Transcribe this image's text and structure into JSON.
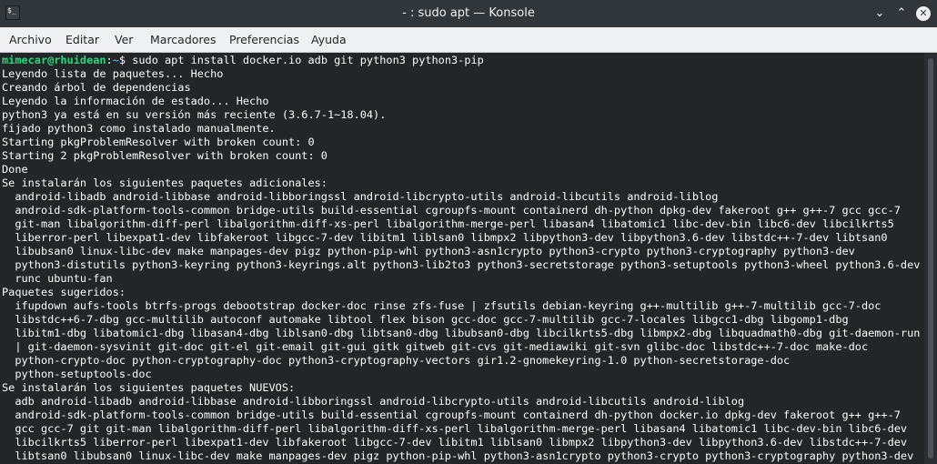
{
  "window": {
    "app_icon_text": "$_",
    "title": "- : sudo apt — Konsole",
    "minimize_glyph": "⌄",
    "maximize_glyph": "⌃",
    "close_glyph": "✕"
  },
  "menu": [
    "Archivo",
    "Editar",
    "Ver",
    "Marcadores",
    "Preferencias",
    "Ayuda"
  ],
  "terminal": {
    "prompt_user": "mimecar@rhuidean",
    "prompt_sep": ":",
    "prompt_path": "~",
    "prompt_symbol": "$ ",
    "command": "sudo apt install docker.io adb git python3 python3-pip",
    "lines": [
      "Leyendo lista de paquetes... Hecho",
      "Creando árbol de dependencias",
      "Leyendo la información de estado... Hecho",
      "python3 ya está en su versión más reciente (3.6.7-1~18.04).",
      "fijado python3 como instalado manualmente.",
      "Starting pkgProblemResolver with broken count: 0",
      "Starting 2 pkgProblemResolver with broken count: 0",
      "Done",
      "Se instalarán los siguientes paquetes adicionales:",
      "  android-libadb android-libbase android-libboringssl android-libcrypto-utils android-libcutils android-liblog",
      "  android-sdk-platform-tools-common bridge-utils build-essential cgroupfs-mount containerd dh-python dpkg-dev fakeroot g++ g++-7 gcc gcc-7",
      "  git-man libalgorithm-diff-perl libalgorithm-diff-xs-perl libalgorithm-merge-perl libasan4 libatomic1 libc-dev-bin libc6-dev libcilkrts5",
      "  liberror-perl libexpat1-dev libfakeroot libgcc-7-dev libitm1 liblsan0 libmpx2 libpython3-dev libpython3.6-dev libstdc++-7-dev libtsan0",
      "  libubsan0 linux-libc-dev make manpages-dev pigz python-pip-whl python3-asn1crypto python3-crypto python3-cryptography python3-dev",
      "  python3-distutils python3-keyring python3-keyrings.alt python3-lib2to3 python3-secretstorage python3-setuptools python3-wheel python3.6-dev",
      "  runc ubuntu-fan",
      "Paquetes sugeridos:",
      "  ifupdown aufs-tools btrfs-progs debootstrap docker-doc rinse zfs-fuse | zfsutils debian-keyring g++-multilib g++-7-multilib gcc-7-doc",
      "  libstdc++6-7-dbg gcc-multilib autoconf automake libtool flex bison gcc-doc gcc-7-multilib gcc-7-locales libgcc1-dbg libgomp1-dbg",
      "  libitm1-dbg libatomic1-dbg libasan4-dbg liblsan0-dbg libtsan0-dbg libubsan0-dbg libcilkrts5-dbg libmpx2-dbg libquadmath0-dbg git-daemon-run",
      "  | git-daemon-sysvinit git-doc git-el git-email git-gui gitk gitweb git-cvs git-mediawiki git-svn glibc-doc libstdc++-7-doc make-doc",
      "  python-crypto-doc python-cryptography-doc python3-cryptography-vectors gir1.2-gnomekeyring-1.0 python-secretstorage-doc",
      "  python-setuptools-doc",
      "Se instalarán los siguientes paquetes NUEVOS:",
      "  adb android-libadb android-libbase android-libboringssl android-libcrypto-utils android-libcutils android-liblog",
      "  android-sdk-platform-tools-common bridge-utils build-essential cgroupfs-mount containerd dh-python docker.io dpkg-dev fakeroot g++ g++-7",
      "  gcc gcc-7 git git-man libalgorithm-diff-perl libalgorithm-diff-xs-perl libalgorithm-merge-perl libasan4 libatomic1 libc-dev-bin libc6-dev",
      "  libcilkrts5 liberror-perl libexpat1-dev libfakeroot libgcc-7-dev libitm1 liblsan0 libmpx2 libpython3-dev libpython3.6-dev libstdc++-7-dev",
      "  libtsan0 libubsan0 linux-libc-dev make manpages-dev pigz python-pip-whl python3-asn1crypto python3-crypto python3-cryptography python3-dev"
    ]
  },
  "colors": {
    "terminal_bg": "#232629",
    "terminal_fg": "#fcfcfc",
    "prompt_user": "#2bd77a",
    "prompt_path": "#3daee9",
    "titlebar_bg": "#31363b",
    "menubar_bg": "#eff0f1"
  }
}
